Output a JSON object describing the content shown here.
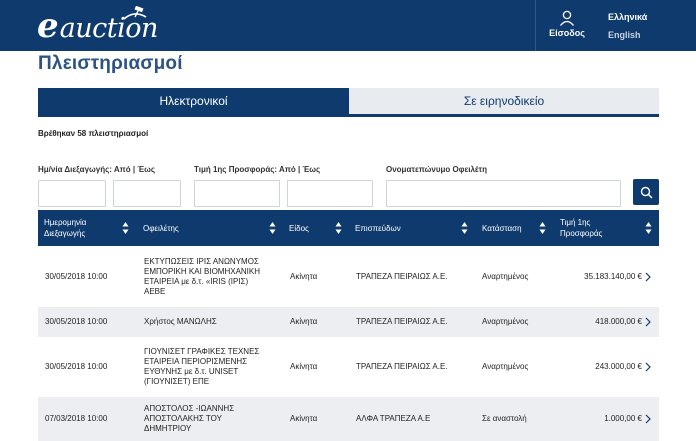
{
  "header": {
    "logo_e": "e",
    "logo_word": "auction",
    "login_label": "Είσοδος",
    "lang_el": "Ελληνικά",
    "lang_en": "English"
  },
  "page_title": "Πλειστηριασμοί",
  "tabs": [
    {
      "label": "Ηλεκτρονικοί",
      "active": true
    },
    {
      "label": "Σε ειρηνοδικείο",
      "active": false
    }
  ],
  "results_text": "Βρέθηκαν 58 πλειστηριασμοί",
  "filters": {
    "date_label": "Ημ/νία Διεξαγωγής: Από | Έως",
    "price_label": "Τιμή 1ης Προσφοράς: Από | Έως",
    "debtor_label": "Ονοματεπώνυμο Οφειλέτη"
  },
  "columns": [
    "Ημερομηνία\nΔιεξαγωγής",
    "Οφειλέτης",
    "Είδος",
    "Επισπεύδων",
    "Κατάσταση",
    "Τιμή 1ης\nΠροσφοράς"
  ],
  "rows": [
    {
      "date": "30/05/2018 10:00",
      "debtor": "ΕΚΤΥΠΩΣΕΙΣ ΙΡΙΣ ΑΝΩΝΥΜΟΣ\nΕΜΠΟΡΙΚΗ ΚΑΙ ΒΙΟΜΗΧΑΝΙΚΗ\nΕΤΑΙΡΕΙΑ με δ.τ. «IRIS (ΙΡΙΣ)\nΑΕΒΕ",
      "type": "Ακίνητα",
      "creditor": "ΤΡΑΠΕΖΑ ΠΕΙΡΑΙΩΣ Α.Ε.",
      "status": "Αναρτημένος",
      "price": "35.183.140,00 €"
    },
    {
      "date": "30/05/2018 10:00",
      "debtor": "Χρήστος ΜΑΝΩΛΗΣ",
      "type": "Ακίνητα",
      "creditor": "ΤΡΑΠΕΖΑ ΠΕΙΡΑΙΩΣ Α.Ε.",
      "status": "Αναρτημένος",
      "price": "418.000,00 €"
    },
    {
      "date": "30/05/2018 10:00",
      "debtor": "ΓΙΟΥΝΙΣΕΤ ΓΡΑΦΙΚΕΣ ΤΕΧΝΕΣ\nΕΤΑΙΡΕΙΑ ΠΕΡΙΟΡΙΣΜΕΝΗΣ\nΕΥΘΥΝΗΣ με δ.τ. UNISET\n(ΓΙΟΥΝΙΣΕΤ) ΕΠΕ",
      "type": "Ακίνητα",
      "creditor": "ΤΡΑΠΕΖΑ ΠΕΙΡΑΙΩΣ Α.Ε.",
      "status": "Αναρτημένος",
      "price": "243.000,00 €"
    },
    {
      "date": "07/03/2018 10:00",
      "debtor": "ΑΠΟΣΤΟΛΟΣ -ΙΩΑΝΝΗΣ\nΑΠΟΣΤΟΛΑΚΗΣ ΤΟΥ\nΔΗΜΗΤΡΙΟΥ",
      "type": "Ακίνητα",
      "creditor": "ΑΛΦΑ ΤΡΑΠΕΖΑ Α.Ε",
      "status": "Σε αναστολή",
      "price": "1.000,00 €"
    }
  ],
  "colors": {
    "primary": "#0f3a6e",
    "title": "#2c5384",
    "row_alt": "#eceef1"
  }
}
